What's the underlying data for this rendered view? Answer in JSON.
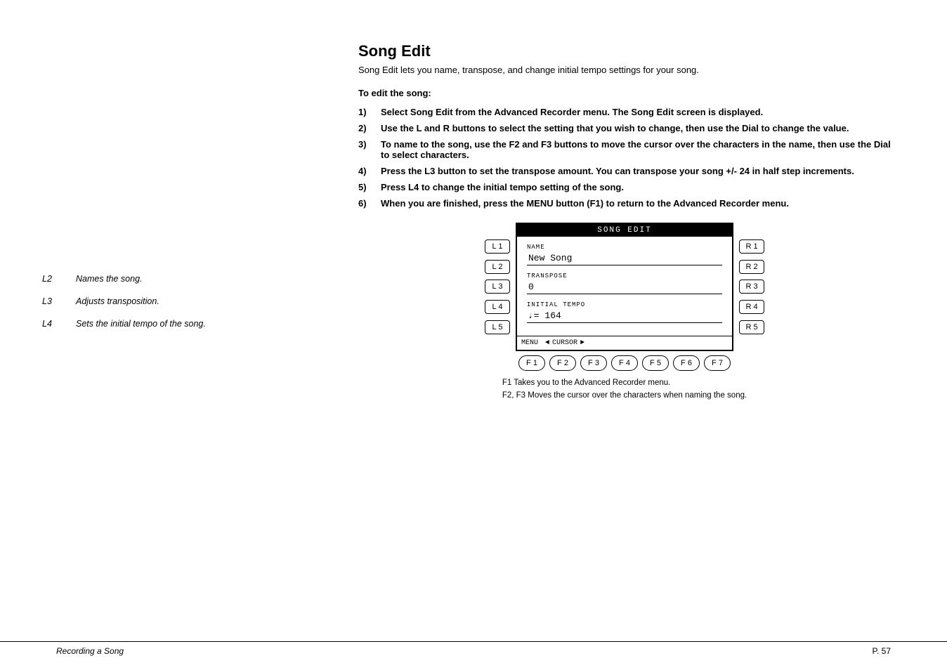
{
  "page": {
    "title": "Song Edit",
    "subtitle": "Song Edit lets you name, transpose, and change initial tempo settings for your song.",
    "to_edit_label": "To edit the song:",
    "steps": [
      {
        "num": "1)",
        "text": "Select Song Edit from the Advanced Recorder menu.  The Song Edit screen is displayed."
      },
      {
        "num": "2)",
        "text": "Use the L and R buttons to select the setting that you wish to change, then use the Dial to change the value."
      },
      {
        "num": "3)",
        "text": "To name to the song, use the F2 and F3 buttons to move the cursor over the characters in the name, then use the Dial to select characters."
      },
      {
        "num": "4)",
        "text": "Press the L3 button to set the transpose amount.  You can transpose your song +/- 24 in half step increments."
      },
      {
        "num": "5)",
        "text": "Press L4 to change the initial tempo setting of the song."
      },
      {
        "num": "6)",
        "text": "When you are finished, press the MENU button (F1) to return to the Advanced Recorder menu."
      }
    ],
    "lcd": {
      "title": "SONG EDIT",
      "fields": [
        {
          "label": "NAME",
          "value": "New Song"
        },
        {
          "label": "TRANSPOSE",
          "value": "0"
        },
        {
          "label": "INITIAL TEMPO",
          "value": "♩= 164"
        }
      ],
      "bottom_bar": {
        "menu": "MENU",
        "cursor_left": "◄",
        "cursor_text": "CURSOR",
        "cursor_right": "►"
      }
    },
    "left_buttons": [
      "L 1",
      "L 2",
      "L 3",
      "L 4",
      "L 5"
    ],
    "right_buttons": [
      "R 1",
      "R 2",
      "R 3",
      "R 4",
      "R 5"
    ],
    "function_buttons": [
      "F 1",
      "F 2",
      "F 3",
      "F 4",
      "F 5",
      "F 6",
      "F 7"
    ],
    "footnotes": [
      "F1        Takes you to the Advanced Recorder menu.",
      "F2, F3   Moves the cursor over the characters when naming the song."
    ],
    "sidebar_annotations": [
      {
        "key": "L2",
        "desc": "Names the song."
      },
      {
        "key": "L3",
        "desc": "Adjusts transposition."
      },
      {
        "key": "L4",
        "desc": "Sets the initial tempo of the song."
      }
    ],
    "footer": {
      "left": "Recording a Song",
      "right": "P. 57"
    }
  }
}
